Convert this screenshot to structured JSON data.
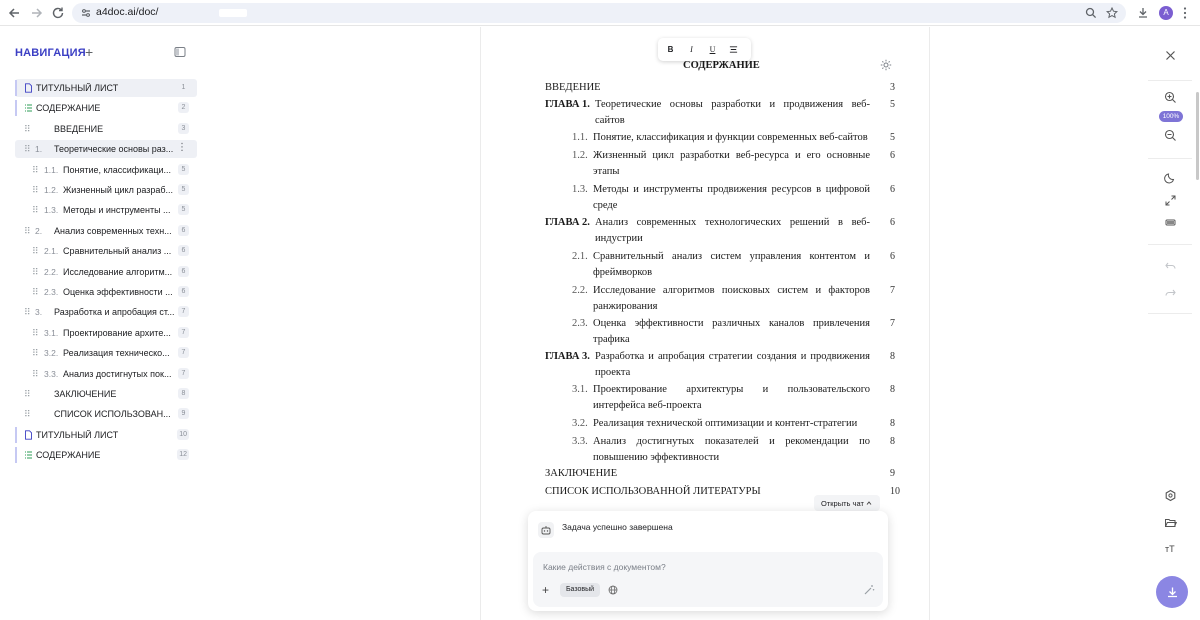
{
  "browser": {
    "url": "a4doc.ai/doc/",
    "avatar_letter": "A"
  },
  "nav": {
    "title": "НАВИГАЦИЯ",
    "items": [
      {
        "type": "doc",
        "label": "ТИТУЛЬНЫЙ ЛИСТ",
        "num": "",
        "page": "1"
      },
      {
        "type": "list",
        "label": "СОДЕРЖАНИЕ",
        "num": "",
        "page": "2"
      },
      {
        "type": "section",
        "label": "ВВЕДЕНИЕ",
        "num": "",
        "page": "3"
      },
      {
        "type": "section",
        "label": "Теоретические основы раз...",
        "num": "1.",
        "page": ""
      },
      {
        "type": "sub",
        "label": "Понятие, классификаци...",
        "num": "1.1.",
        "page": "5"
      },
      {
        "type": "sub",
        "label": "Жизненный цикл разраб...",
        "num": "1.2.",
        "page": "5"
      },
      {
        "type": "sub",
        "label": "Методы и инструменты ...",
        "num": "1.3.",
        "page": "5"
      },
      {
        "type": "section",
        "label": "Анализ современных техн...",
        "num": "2.",
        "page": "6"
      },
      {
        "type": "sub",
        "label": "Сравнительный анализ ...",
        "num": "2.1.",
        "page": "6"
      },
      {
        "type": "sub",
        "label": "Исследование алгоритм...",
        "num": "2.2.",
        "page": "6"
      },
      {
        "type": "sub",
        "label": "Оценка эффективности ...",
        "num": "2.3.",
        "page": "6"
      },
      {
        "type": "section",
        "label": "Разработка и апробация ст...",
        "num": "3.",
        "page": "7"
      },
      {
        "type": "sub",
        "label": "Проектирование архите...",
        "num": "3.1.",
        "page": "7"
      },
      {
        "type": "sub",
        "label": "Реализация техническо...",
        "num": "3.2.",
        "page": "7"
      },
      {
        "type": "sub",
        "label": "Анализ достигнутых пок...",
        "num": "3.3.",
        "page": "7"
      },
      {
        "type": "section",
        "label": "ЗАКЛЮЧЕНИЕ",
        "num": "",
        "page": "8"
      },
      {
        "type": "section",
        "label": "СПИСОК ИСПОЛЬЗОВАН...",
        "num": "",
        "page": "9"
      },
      {
        "type": "doc",
        "label": "ТИТУЛЬНЫЙ ЛИСТ",
        "num": "",
        "page": "10"
      },
      {
        "type": "list",
        "label": "СОДЕРЖАНИЕ",
        "num": "",
        "page": "12"
      }
    ]
  },
  "toolbar": {
    "bold": "B",
    "italic": "I",
    "underline": "U"
  },
  "toc": {
    "title": "СОДЕРЖАНИЕ",
    "entries": [
      {
        "level": 0,
        "prefix": "",
        "text": "ВВЕДЕНИЕ",
        "page": "3"
      },
      {
        "level": 0,
        "prefix": "ГЛАВА 1.",
        "text": "Теоретические основы разработки и продвижения веб-сайтов",
        "page": "5"
      },
      {
        "level": 1,
        "prefix": "1.1.",
        "text": "Понятие, классификация и функции современных веб-сайтов",
        "page": "5"
      },
      {
        "level": 1,
        "prefix": "1.2.",
        "text": "Жизненный цикл разработки веб-ресурса и его основные этапы",
        "page": "6"
      },
      {
        "level": 1,
        "prefix": "1.3.",
        "text": "Методы и инструменты продвижения ресурсов в цифровой среде",
        "page": "6"
      },
      {
        "level": 0,
        "prefix": "ГЛАВА 2.",
        "text": "Анализ современных технологических решений в веб-индустрии",
        "page": "6"
      },
      {
        "level": 1,
        "prefix": "2.1.",
        "text": "Сравнительный анализ систем управления контентом и фреймворков",
        "page": "6"
      },
      {
        "level": 1,
        "prefix": "2.2.",
        "text": "Исследование алгоритмов поисковых систем и факторов ранжирования",
        "page": "7"
      },
      {
        "level": 1,
        "prefix": "2.3.",
        "text": "Оценка эффективности различных каналов привлечения трафика",
        "page": "7"
      },
      {
        "level": 0,
        "prefix": "ГЛАВА 3.",
        "text": "Разработка и апробация стратегии создания и продвижения проекта",
        "page": "8"
      },
      {
        "level": 1,
        "prefix": "3.1.",
        "text": "Проектирование архитектуры и пользовательского интерфейса веб-проекта",
        "page": "8"
      },
      {
        "level": 1,
        "prefix": "3.2.",
        "text": "Реализация технической оптимизации и контент-стратегии",
        "page": "8"
      },
      {
        "level": 1,
        "prefix": "3.3.",
        "text": "Анализ достигнутых показателей и рекомендации по повышению эффективности",
        "page": "8"
      },
      {
        "level": 0,
        "prefix": "",
        "text": "ЗАКЛЮЧЕНИЕ",
        "page": "9"
      },
      {
        "level": 0,
        "prefix": "",
        "text": "СПИСОК ИСПОЛЬЗОВАННОЙ ЛИТЕРАТУРЫ",
        "page": "10"
      }
    ]
  },
  "chat": {
    "open_label": "Открыть чат",
    "status": "Задача успешно завершена",
    "placeholder": "Какие действия с документом?",
    "mode": "Базовый"
  },
  "right_toolbar": {
    "zoom": "100%",
    "text_size": "тТ"
  },
  "colors": {
    "accent": "#3b3fc4",
    "fab": "#8b86e3",
    "zoom_badge": "#7e74d6"
  }
}
